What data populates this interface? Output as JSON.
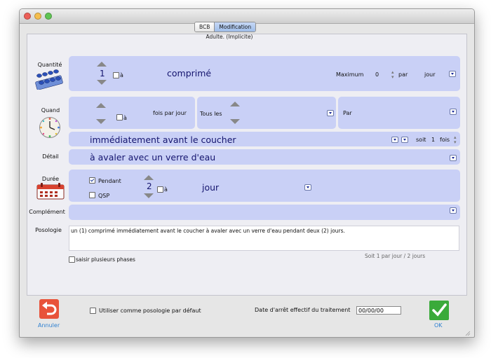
{
  "tabs": {
    "bcb": "BCB",
    "modification": "Modification"
  },
  "subtitle": "Adulte. (Implicite)",
  "quantite": {
    "label": "Quantité",
    "value": "1",
    "a_label": "à",
    "unit": "comprimé",
    "maximum_label": "Maximum",
    "maximum_value": "0",
    "par_label": "par",
    "per_unit": "jour"
  },
  "quand": {
    "label": "Quand",
    "a_label": "à",
    "fois_par_jour": "fois par jour",
    "tous_les": "Tous les",
    "par": "Par",
    "moment": "immédiatement avant le coucher",
    "soit_label": "soit",
    "soit_value": "1",
    "fois_label": "fois"
  },
  "detail": {
    "label": "Détail",
    "value": "à avaler avec un verre d'eau"
  },
  "duree": {
    "label": "Durée",
    "pendant_label": "Pendant",
    "pendant_checked": true,
    "qsp_label": "QSP",
    "qsp_checked": false,
    "value": "2",
    "a_label": "à",
    "unit": "jour"
  },
  "complement": {
    "label": "Complément",
    "value": ""
  },
  "posologie": {
    "label": "Posologie",
    "text": "un (1) comprimé immédiatement avant le coucher à avaler avec un verre d'eau pendant deux (2) jours."
  },
  "saisir_label": "saisir plusieurs phases",
  "summary": "Soit 1 par jour / 2 jours",
  "footer": {
    "cancel_label": "Annuler",
    "default_label": "Utiliser comme posologie par défaut",
    "date_label": "Date d'arrêt effectif du traitement",
    "date_value": "00/00/00",
    "ok_label": "OK"
  },
  "colors": {
    "panel": "#c9d0f6",
    "text_dark_blue": "#14146e",
    "cancel_red": "#e8533a",
    "ok_green": "#3aaa3a",
    "link_blue": "#2f80d0"
  },
  "icons": {
    "quantite": "pills-icon",
    "quand": "clock-icon",
    "duree": "calendar-icon",
    "cancel": "undo-arrow-icon",
    "ok": "checkmark-icon"
  }
}
